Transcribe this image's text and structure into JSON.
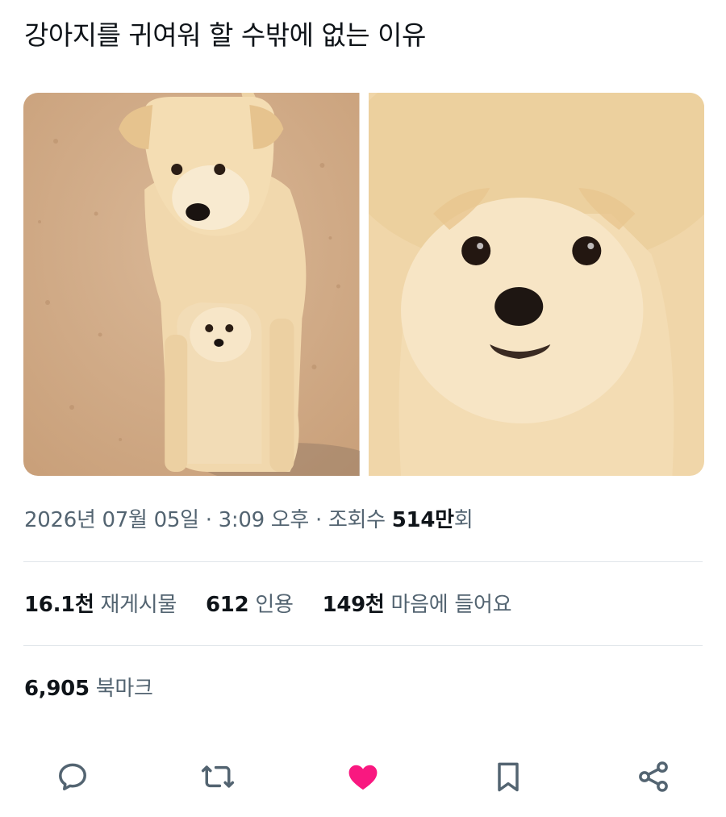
{
  "post": {
    "title": "강아지를 귀여워 할 수밖에 없는 이유",
    "media": {
      "images": [
        {
          "label": "adult dog standing over puppy"
        },
        {
          "label": "close-up of puppy face"
        }
      ]
    },
    "meta": {
      "date": "2026년 07월 05일",
      "sep1": " · ",
      "time": "3:09 오후",
      "sep2": " · ",
      "views_label": "조회수 ",
      "views_value": "514만",
      "views_suffix": "회"
    },
    "stats": {
      "reposts": {
        "value": "16.1천",
        "label": "재게시물"
      },
      "quotes": {
        "value": "612",
        "label": "인용"
      },
      "likes": {
        "value": "149천",
        "label": "마음에 들어요"
      }
    },
    "bookmarks": {
      "value": "6,905",
      "label": "북마크"
    },
    "actions": [
      {
        "icon": "reply-icon"
      },
      {
        "icon": "repost-icon"
      },
      {
        "icon": "heart-icon",
        "active": true,
        "color": "#f91880"
      },
      {
        "icon": "bookmark-icon"
      },
      {
        "icon": "share-icon"
      }
    ]
  },
  "colors": {
    "text": "#0f1419",
    "secondary": "#536471",
    "divider": "#e1e6ea",
    "like": "#f91880"
  }
}
